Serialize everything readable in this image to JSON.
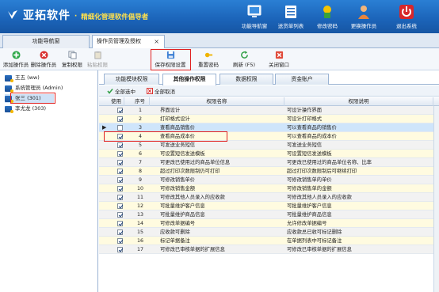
{
  "header": {
    "app_name": "亚拓软件",
    "dot": "·",
    "slogan": "精细化管理软件倡导者",
    "buttons": [
      {
        "label": "功能导航窗",
        "icon": "monitor-icon"
      },
      {
        "label": "送货单列表",
        "icon": "list-icon"
      },
      {
        "label": "修改密码",
        "icon": "key-icon"
      },
      {
        "label": "更换操作员",
        "icon": "user-icon"
      },
      {
        "label": "退出系统",
        "icon": "power-icon"
      }
    ]
  },
  "tabs": [
    {
      "label": "功能导航窗"
    },
    {
      "label": "操作员管理及授权",
      "close": "×"
    }
  ],
  "toolbar": [
    {
      "label": "添加操作员",
      "icon": "add-icon",
      "enabled": true
    },
    {
      "label": "删除操作员",
      "icon": "delete-icon",
      "enabled": true
    },
    {
      "label": "复制权限",
      "icon": "copy-icon",
      "enabled": true
    },
    {
      "label": "粘贴权限",
      "icon": "paste-icon",
      "enabled": false
    },
    {
      "label": "保存权限设置",
      "icon": "save-icon",
      "enabled": true
    },
    {
      "label": "重置密码",
      "icon": "key-icon",
      "enabled": true
    },
    {
      "label": "刷新 (F5)",
      "icon": "refresh-icon",
      "enabled": true
    },
    {
      "label": "关闭窗口",
      "icon": "close-icon",
      "enabled": true
    }
  ],
  "operators": [
    {
      "label": "王五 (ww)"
    },
    {
      "label": "系统管理员 (Admin)"
    },
    {
      "label": "张三 (301)"
    },
    {
      "label": "李尤龙 (303)"
    }
  ],
  "subtabs": [
    "功能模块权限",
    "其他操作权限",
    "数据权限",
    "资金账户"
  ],
  "select_all": "全部选中",
  "cancel_all": "全部取消",
  "columns": {
    "use": "使用",
    "seq": "序号",
    "name": "权限名称",
    "desc": "权限说明"
  },
  "current_row_marker": "▶",
  "rows": [
    {
      "checked": true,
      "seq": "1",
      "name": "界面设计",
      "desc": "可设计操作界面"
    },
    {
      "checked": true,
      "seq": "2",
      "name": "打印格式设计",
      "desc": "可设计打印格式"
    },
    {
      "checked": false,
      "seq": "3",
      "name": "查看商品销售价",
      "desc": "可以查看商品的销售价"
    },
    {
      "checked": true,
      "seq": "4",
      "name": "查看商品成本价",
      "desc": "可以查看商品的成本价"
    },
    {
      "checked": true,
      "seq": "5",
      "name": "可发送业务短信",
      "desc": "可发送业务短信"
    },
    {
      "checked": true,
      "seq": "6",
      "name": "可设置短信发送模板",
      "desc": "可设置短信发送模板"
    },
    {
      "checked": true,
      "seq": "7",
      "name": "可更改已使用过的商品单位信息",
      "desc": "可更改已使用过的商品单位名称、比率"
    },
    {
      "checked": true,
      "seq": "8",
      "name": "超过打印次数限制仍可打印",
      "desc": "超过打印次数限制后可继续打印"
    },
    {
      "checked": true,
      "seq": "9",
      "name": "可修改销售单价",
      "desc": "可修改销售单的单价"
    },
    {
      "checked": true,
      "seq": "10",
      "name": "可修改销售金额",
      "desc": "可修改销售单的金额"
    },
    {
      "checked": true,
      "seq": "11",
      "name": "可修改其他人员录入的应收款",
      "desc": "可修改其他人员录入的应收款"
    },
    {
      "checked": true,
      "seq": "12",
      "name": "可批量维护客户信息",
      "desc": "可批量维护客户信息"
    },
    {
      "checked": true,
      "seq": "13",
      "name": "可批量维护商品信息",
      "desc": "可批量维护商品信息"
    },
    {
      "checked": true,
      "seq": "14",
      "name": "可修改单据编号",
      "desc": "允许修改单据编号"
    },
    {
      "checked": true,
      "seq": "15",
      "name": "应收款可删除",
      "desc": "应收款总已收可标记删除"
    },
    {
      "checked": true,
      "seq": "16",
      "name": "标记单据备注",
      "desc": "在单据列表中可标记备注"
    },
    {
      "checked": true,
      "seq": "17",
      "name": "可修改已审核单据的扩展信息",
      "desc": "可修改已审核单据的扩展信息"
    }
  ],
  "colors": {
    "header_bg": "#1b63b8",
    "slogan": "#ffe14d",
    "highlight_box": "#e02020",
    "row_even": "#f2f2f2",
    "row_odd": "#fffbe0",
    "row_current": "#cfe5fb"
  }
}
